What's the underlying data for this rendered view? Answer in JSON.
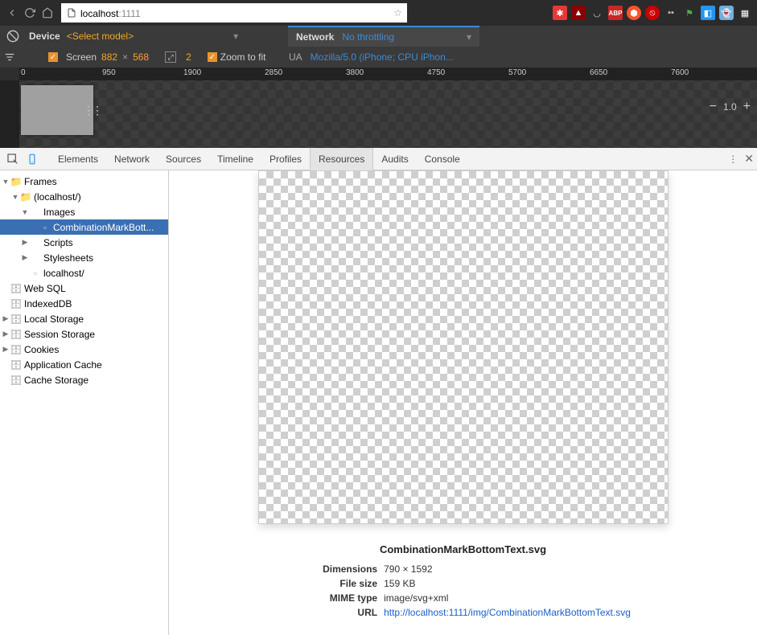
{
  "browser": {
    "address_host": "localhost",
    "address_port": ":1111"
  },
  "device_bar": {
    "device_label": "Device",
    "select_model": "<Select model>",
    "screen_label": "Screen",
    "width": "882",
    "times": "×",
    "height": "568",
    "dpr": "2",
    "zoom_label": "Zoom to fit",
    "network_label": "Network",
    "throttling": "No throttling",
    "ua_label": "UA",
    "ua_value": "Mozilla/5.0 (iPhone; CPU iPhon..."
  },
  "zoom_control": {
    "minus": "−",
    "value": "1.0",
    "plus": "+"
  },
  "ruler_ticks": [
    "0",
    "950",
    "1900",
    "2850",
    "3800",
    "4750",
    "5700",
    "6650",
    "7600"
  ],
  "devtools_tabs": [
    "Elements",
    "Network",
    "Sources",
    "Timeline",
    "Profiles",
    "Resources",
    "Audits",
    "Console"
  ],
  "devtools_active_tab": "Resources",
  "sidebar": {
    "frames": "Frames",
    "localhost": "(localhost/)",
    "images": "Images",
    "selected_image": "CombinationMarkBott...",
    "scripts": "Scripts",
    "stylesheets": "Stylesheets",
    "localhost_file": "localhost/",
    "websql": "Web SQL",
    "indexeddb": "IndexedDB",
    "localstorage": "Local Storage",
    "sessionstorage": "Session Storage",
    "cookies": "Cookies",
    "appcache": "Application Cache",
    "cachestorage": "Cache Storage"
  },
  "resource": {
    "filename": "CombinationMarkBottomText.svg",
    "dim_label": "Dimensions",
    "dim_value": "790 × 1592",
    "size_label": "File size",
    "size_value": "159 KB",
    "mime_label": "MIME type",
    "mime_value": "image/svg+xml",
    "url_label": "URL",
    "url_value": "http://localhost:1111/img/CombinationMarkBottomText.svg"
  }
}
